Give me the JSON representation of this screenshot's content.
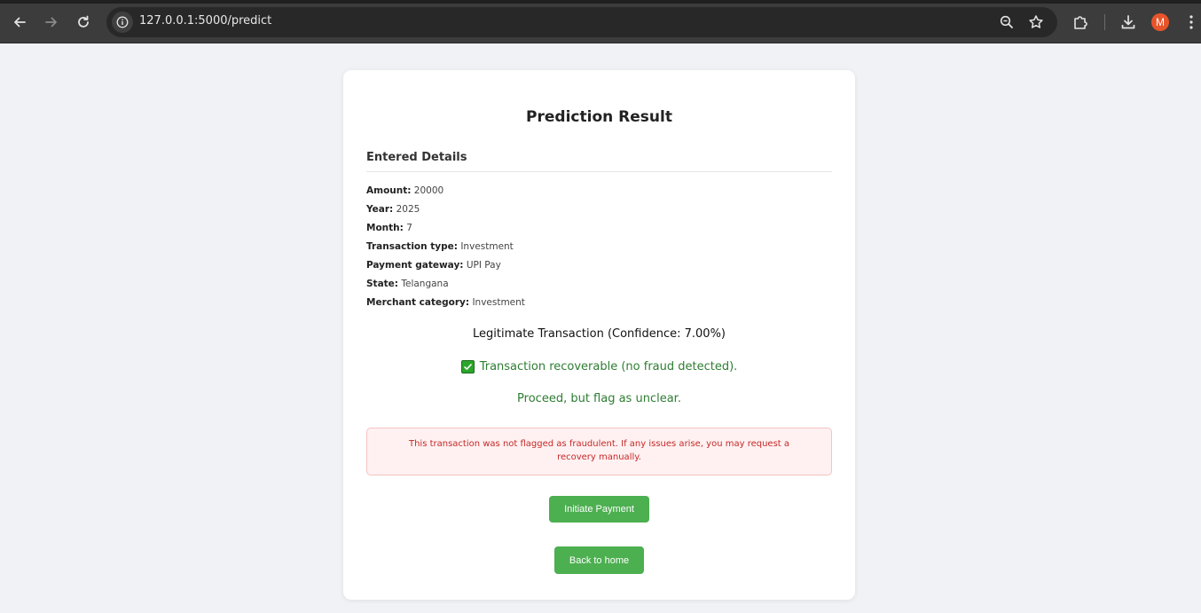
{
  "browser": {
    "url": "127.0.0.1:5000/predict",
    "avatar_letter": "M",
    "icons": {
      "back": "arrow-left-icon",
      "forward": "arrow-right-icon",
      "reload": "reload-icon",
      "site_info": "info-icon",
      "zoom": "zoom-icon",
      "bookmark": "star-icon",
      "extensions": "puzzle-icon",
      "downloads": "download-icon",
      "menu": "kebab-icon"
    }
  },
  "page": {
    "title": "Prediction Result",
    "section_heading": "Entered Details",
    "details": [
      {
        "label": "Amount:",
        "value": "20000"
      },
      {
        "label": "Year:",
        "value": "2025"
      },
      {
        "label": "Month:",
        "value": "7"
      },
      {
        "label": "Transaction type:",
        "value": "Investment"
      },
      {
        "label": "Payment gateway:",
        "value": "UPI Pay"
      },
      {
        "label": "State:",
        "value": "Telangana"
      },
      {
        "label": "Merchant category:",
        "value": "Investment"
      }
    ],
    "verdict": "Legitimate Transaction (Confidence: 7.00%)",
    "recoverable": "Transaction recoverable (no fraud detected).",
    "advice": "Proceed, but flag as unclear.",
    "alert": "This transaction was not flagged as fraudulent. If any issues arise, you may request a recovery manually.",
    "initiate_payment_label": "Initiate Payment",
    "back_home_label": "Back to home"
  },
  "colors": {
    "accent_green": "#4caf50",
    "success_text": "#2e7d32",
    "alert_text": "#c62828",
    "alert_bg": "#fff1f1"
  }
}
